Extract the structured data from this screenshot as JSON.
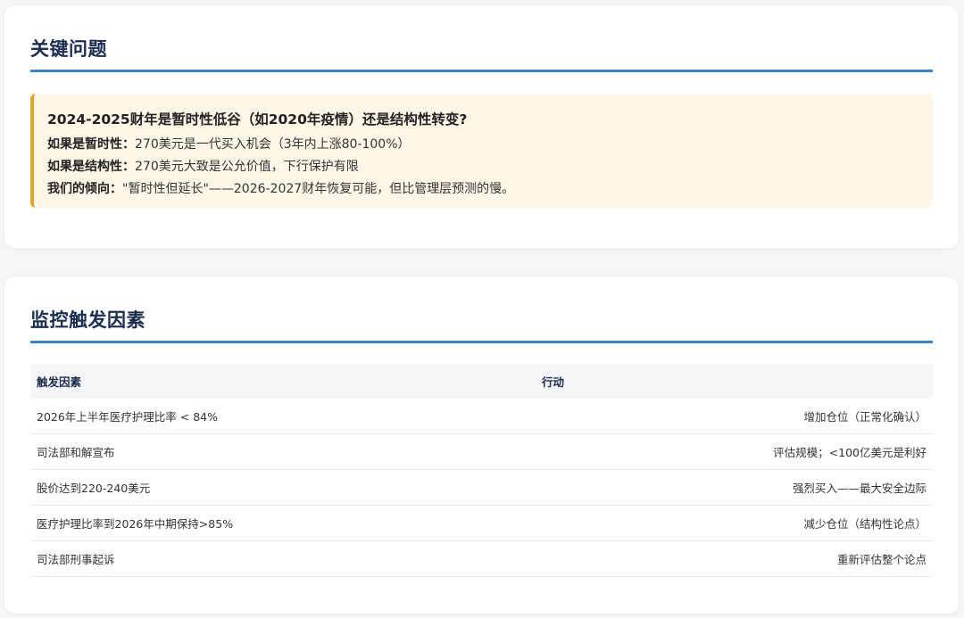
{
  "key_question": {
    "title": "关键问题",
    "question": "2024-2025财年是暂时性低谷（如2020年疫情）还是结构性转变?",
    "lines": [
      {
        "label": "如果是暂时性：",
        "text": "270美元是一代买入机会（3年内上涨80-100%）"
      },
      {
        "label": "如果是结构性：",
        "text": "270美元大致是公允价值，下行保护有限"
      },
      {
        "label": "我们的倾向：",
        "text": "\"暂时性但延长\"——2026-2027财年恢复可能，但比管理层预测的慢。"
      }
    ],
    "accent_color": "#e0a72c"
  },
  "triggers": {
    "title": "监控触发因素",
    "headers": [
      "触发因素",
      "行动"
    ],
    "rows": [
      {
        "trigger": "2026年上半年医疗护理比率 < 84%",
        "action": "增加仓位（正常化确认）",
        "tone": "green"
      },
      {
        "trigger": "司法部和解宣布",
        "action": "评估规模；<100亿美元是利好",
        "tone": "dark"
      },
      {
        "trigger": "股价达到220-240美元",
        "action": "强烈买入——最大安全边际",
        "tone": "green"
      },
      {
        "trigger": "医疗护理比率到2026年中期保持>85%",
        "action": "减少仓位（结构性论点）",
        "tone": "red"
      },
      {
        "trigger": "司法部刑事起诉",
        "action": "重新评估整个论点",
        "tone": "red"
      }
    ],
    "colors": {
      "green": "#3a9a5b",
      "dark": "#333333",
      "red": "#d9443c",
      "underline": "#3a84c8"
    }
  }
}
